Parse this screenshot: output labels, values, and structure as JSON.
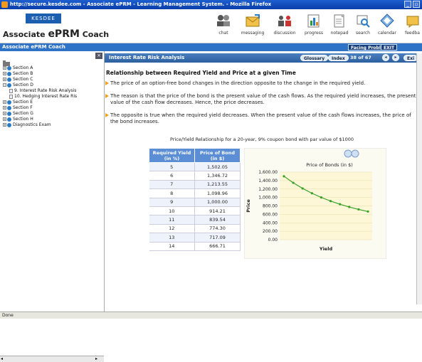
{
  "window": {
    "title": "http://secure.kesdee.com - Associate ePRM - Learning Management System. - Mozilla Firefox"
  },
  "brand": {
    "logo": "KESDEE",
    "name_prefix": "Associate ",
    "name_prm": "ePRM",
    "name_suffix": " Coach"
  },
  "nav": [
    {
      "label": "chat",
      "icon": "chat-icon"
    },
    {
      "label": "messaging",
      "icon": "messaging-icon"
    },
    {
      "label": "discussion",
      "icon": "discussion-icon"
    },
    {
      "label": "progress",
      "icon": "progress-icon"
    },
    {
      "label": "notepad",
      "icon": "notepad-icon"
    },
    {
      "label": "search",
      "icon": "search-icon"
    },
    {
      "label": "calendar",
      "icon": "calendar-icon"
    },
    {
      "label": "feedba",
      "icon": "feedback-icon"
    }
  ],
  "subbar": {
    "title": "Associate ePRM Coach",
    "problems": "Facing Problem?",
    "exit": "EXIT"
  },
  "tree": [
    {
      "label": "Section A",
      "type": "section",
      "pm": "+"
    },
    {
      "label": "Section B",
      "type": "section",
      "pm": "+"
    },
    {
      "label": "Section C",
      "type": "section",
      "pm": "+"
    },
    {
      "label": "Section D",
      "type": "section",
      "pm": "−"
    },
    {
      "label": "9. Interest Rate Risk Analysis",
      "type": "doc"
    },
    {
      "label": "10. Hedging Interest Rate Ris",
      "type": "doc"
    },
    {
      "label": "Section E",
      "type": "section",
      "pm": "+"
    },
    {
      "label": "Section F",
      "type": "section",
      "pm": "+"
    },
    {
      "label": "Section G",
      "type": "section",
      "pm": "+"
    },
    {
      "label": "Section H",
      "type": "section",
      "pm": "+"
    },
    {
      "label": "Diagnostics Exam",
      "type": "section",
      "pm": "+"
    }
  ],
  "content": {
    "title": "Interest Rate Risk Analysis",
    "glossary": "Glossary",
    "index": "Index",
    "page": "38 of 67",
    "exit": "Exi",
    "heading": "Relationship between Required Yield and Price at a given Time",
    "paragraphs": [
      "The price of an option-free bond changes in the direction opposite to the change in the required yield.",
      "The reason is that the price of the bond is the present value of the cash flows. As the required yield increases, the present value of the cash flow decreases. Hence, the price decreases.",
      "The opposite is true when the required yield decreases. When the present value of the cash flows increases, the price of the bond increases."
    ],
    "caption": "Price/Yield Relationship for a 20-year, 9% coupon bond with par value of $1000",
    "table": {
      "headers": [
        "Required Yield (in %)",
        "Price of Bond (in $)"
      ],
      "rows": [
        [
          "5",
          "1,502.05"
        ],
        [
          "6",
          "1,346.72"
        ],
        [
          "7",
          "1,213.55"
        ],
        [
          "8",
          "1,098.96"
        ],
        [
          "9",
          "1,000.00"
        ],
        [
          "10",
          "914.21"
        ],
        [
          "11",
          "839.54"
        ],
        [
          "12",
          "774.30"
        ],
        [
          "13",
          "717.09"
        ],
        [
          "14",
          "666.71"
        ]
      ]
    }
  },
  "chart_data": {
    "type": "line",
    "title": "Price of Bonds (in $)",
    "xlabel": "Yield",
    "ylabel": "Price",
    "x": [
      5,
      6,
      7,
      8,
      9,
      10,
      11,
      12,
      13,
      14
    ],
    "series": [
      {
        "values": [
          1502.05,
          1346.72,
          1213.55,
          1098.96,
          1000.0,
          914.21,
          839.54,
          774.3,
          717.09,
          666.71
        ]
      }
    ],
    "yticks": [
      "1,600.00",
      "1,400.00",
      "1,200.00",
      "1,000.00",
      "800.00",
      "600.00",
      "400.00",
      "200.00",
      "0.00"
    ],
    "ylim": [
      0,
      1600
    ],
    "grid": true,
    "color": "#3aa02a"
  },
  "status": {
    "text": "Done"
  }
}
